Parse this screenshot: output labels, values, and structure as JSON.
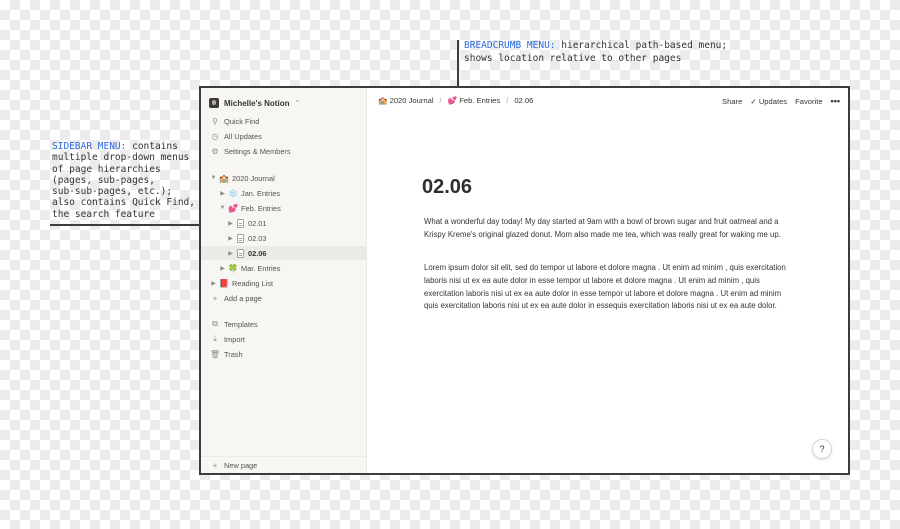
{
  "annotations": {
    "breadcrumb_title": "BREADCRUMB MENU:",
    "breadcrumb_text_1": "hierarchical path-based menu;",
    "breadcrumb_text_2": "shows location relative to other pages",
    "sidebar_title": "SIDEBAR MENU:",
    "sidebar_text_1": "contains",
    "sidebar_lines": [
      "multiple drop-down menus",
      "of page hierarchies",
      "(pages, sub-pages,",
      "sub-sub-pages, etc.);",
      "also contains Quick Find,",
      "the search feature"
    ]
  },
  "sidebar": {
    "workspace": "Michelle's Notion",
    "workspace_caret": "⌃",
    "quick_find": "Quick Find",
    "all_updates": "All Updates",
    "settings": "Settings & Members",
    "tree": {
      "journal": {
        "emoji": "🏫",
        "label": "2020 Journal"
      },
      "jan": {
        "emoji": "❄️",
        "label": "Jan. Entries"
      },
      "feb": {
        "emoji": "💕",
        "label": "Feb. Entries"
      },
      "e1": "02.01",
      "e2": "02.03",
      "e3": "02.06",
      "mar": {
        "emoji": "🍀",
        "label": "Mar. Entries"
      },
      "reading": {
        "emoji": "📕",
        "label": "Reading List"
      }
    },
    "add_page": "Add a page",
    "templates": "Templates",
    "import": "Import",
    "trash": "Trash",
    "new_page": "New page"
  },
  "breadcrumb": [
    {
      "emoji": "🏫",
      "label": "2020 Journal"
    },
    {
      "emoji": "💕",
      "label": "Feb. Entries"
    },
    {
      "emoji": "",
      "label": "02.06"
    }
  ],
  "breadcrumb_sep": "/",
  "topbar": {
    "share": "Share",
    "updates_check": "✓",
    "updates": "Updates",
    "favorite": "Favorite",
    "more": "•••"
  },
  "page": {
    "title": "02.06",
    "para1": "What a wonderful day today! My day started at 9am with a bowl of brown sugar and fruit oatmeal and a Krispy Kreme's original glazed donut. Mom also made me tea, which was really great for waking me up.",
    "para2": "Lorem ipsum dolor sit elit, sed do tempor ut labore et dolore magna . Ut enim ad minim , quis exercitation laboris nisi ut ex ea aute dolor in esse tempor ut labore et dolore magna . Ut enim ad minim , quis exercitation laboris nisi ut ex ea aute dolor in esse tempor ut labore et dolore magna . Ut enim ad minim quis exercitation laboris nisi ut ex ea aute dolor in essequis exercitation laboris nisi ut ex ea aute dolor."
  },
  "help": "?"
}
